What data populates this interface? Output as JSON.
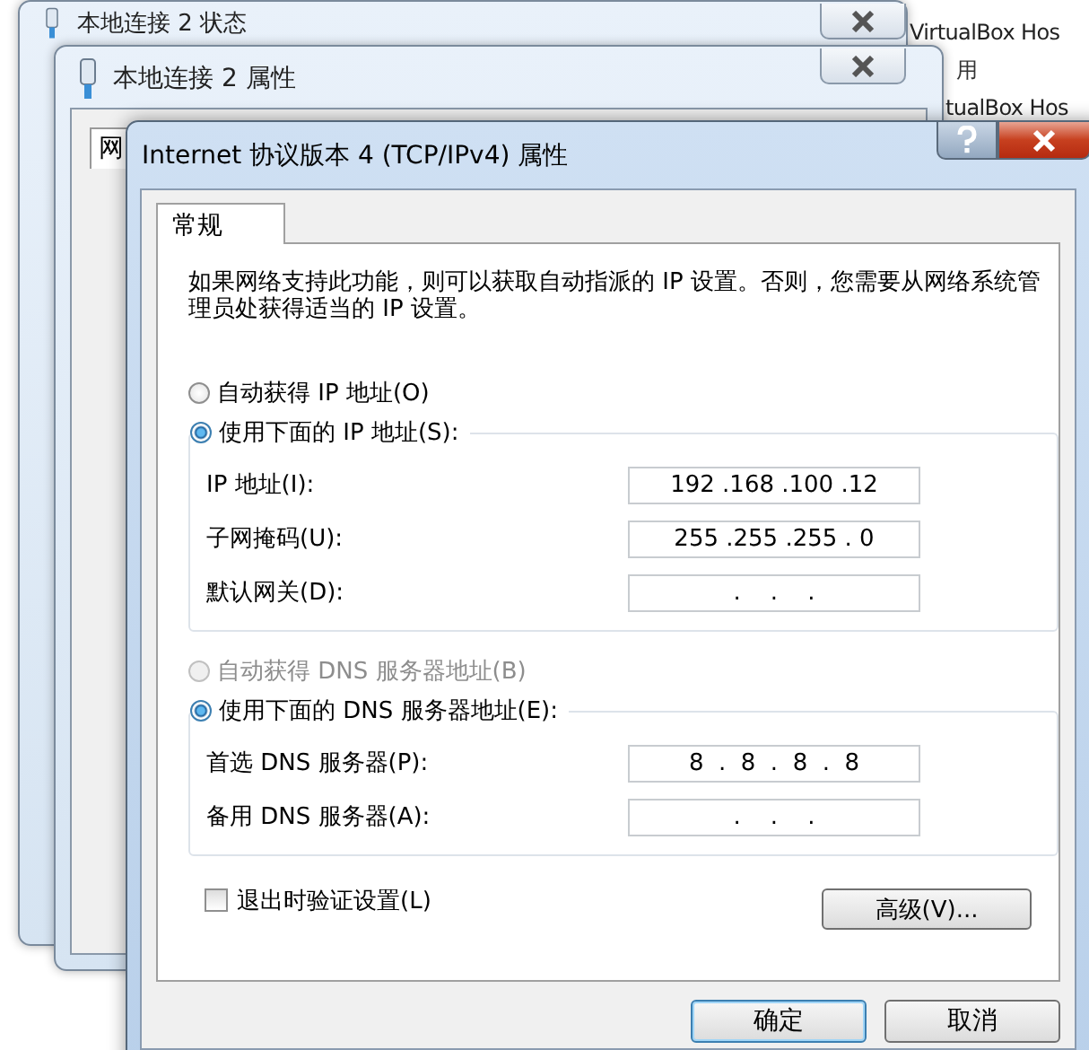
{
  "background_windows": [
    {
      "title": "本地连接 2 状态"
    },
    {
      "title": "本地连接 2 属性",
      "tab": "网"
    }
  ],
  "background_text": [
    "VirtualBox Hos",
    "用",
    "tualBox Hos"
  ],
  "dialog": {
    "title": "Internet 协议版本 4 (TCP/IPv4) 属性",
    "tabs": [
      {
        "label": "常规",
        "selected": true
      }
    ],
    "description": "如果网络支持此功能，则可以获取自动指派的 IP 设置。否则，您需要从网络系统管理员处获得适当的 IP 设置。",
    "ip_mode": [
      {
        "label": "自动获得 IP 地址(O)",
        "selected": false,
        "disabled": false
      },
      {
        "label": "使用下面的 IP 地址(S):",
        "selected": true,
        "disabled": false
      }
    ],
    "ip_fields": [
      {
        "label": "IP 地址(I):",
        "value": "192 .168 .100 .12"
      },
      {
        "label": "子网掩码(U):",
        "value": "255 .255 .255 . 0"
      },
      {
        "label": "默认网关(D):",
        "value": ".    .    ."
      }
    ],
    "dns_mode": [
      {
        "label": "自动获得 DNS 服务器地址(B)",
        "selected": false,
        "disabled": true
      },
      {
        "label": "使用下面的 DNS 服务器地址(E):",
        "selected": true,
        "disabled": false
      }
    ],
    "dns_fields": [
      {
        "label": "首选 DNS 服务器(P):",
        "value": "8  .  8  .  8  .  8"
      },
      {
        "label": "备用 DNS 服务器(A):",
        "value": ".    .    ."
      }
    ],
    "validate_checkbox": {
      "label": "退出时验证设置(L)",
      "checked": false
    },
    "advanced_button": "高级(V)...",
    "buttons": [
      {
        "label": "确定",
        "default": true
      },
      {
        "label": "取消",
        "default": false
      }
    ]
  }
}
